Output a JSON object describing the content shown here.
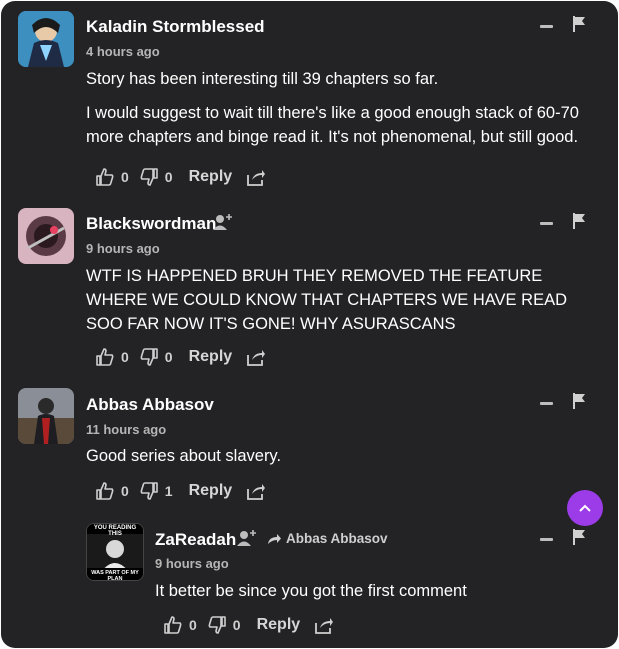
{
  "colors": {
    "panel_bg": "#232325",
    "accent_button": "#9b3ce8",
    "text": "#ffffff",
    "muted": "#b5b5b5"
  },
  "comments": [
    {
      "author": "Kaladin Stormblessed",
      "time": "4 hours ago",
      "text": [
        "Story has been interesting till 39 chapters so far.",
        "I would suggest to wait till there's like a good enough stack of 60-70 more chapters and binge read it. It's not phenomenal, but still good."
      ],
      "likes": "0",
      "dislikes": "0",
      "reply_label": "Reply"
    },
    {
      "author": "Blackswordman",
      "time": "9 hours ago",
      "text": [
        "WTF IS HAPPENED BRUH THEY REMOVED THE FEATURE WHERE WE COULD KNOW THAT CHAPTERS WE HAVE READ SOO FAR NOW IT'S GONE! WHY ASURASCANS"
      ],
      "likes": "0",
      "dislikes": "0",
      "reply_label": "Reply"
    },
    {
      "author": "Abbas Abbasov",
      "time": "11 hours ago",
      "text": [
        "Good series about slavery."
      ],
      "likes": "0",
      "dislikes": "1",
      "reply_label": "Reply"
    },
    {
      "author": "ZaReadah",
      "reply_to": "Abbas Abbasov",
      "time": "9 hours ago",
      "text": [
        "It better be since you got the first comment"
      ],
      "likes": "0",
      "dislikes": "0",
      "reply_label": "Reply",
      "avatar_text_top": "YOU READING THIS",
      "avatar_text_bottom": "WAS PART OF MY PLAN"
    }
  ]
}
